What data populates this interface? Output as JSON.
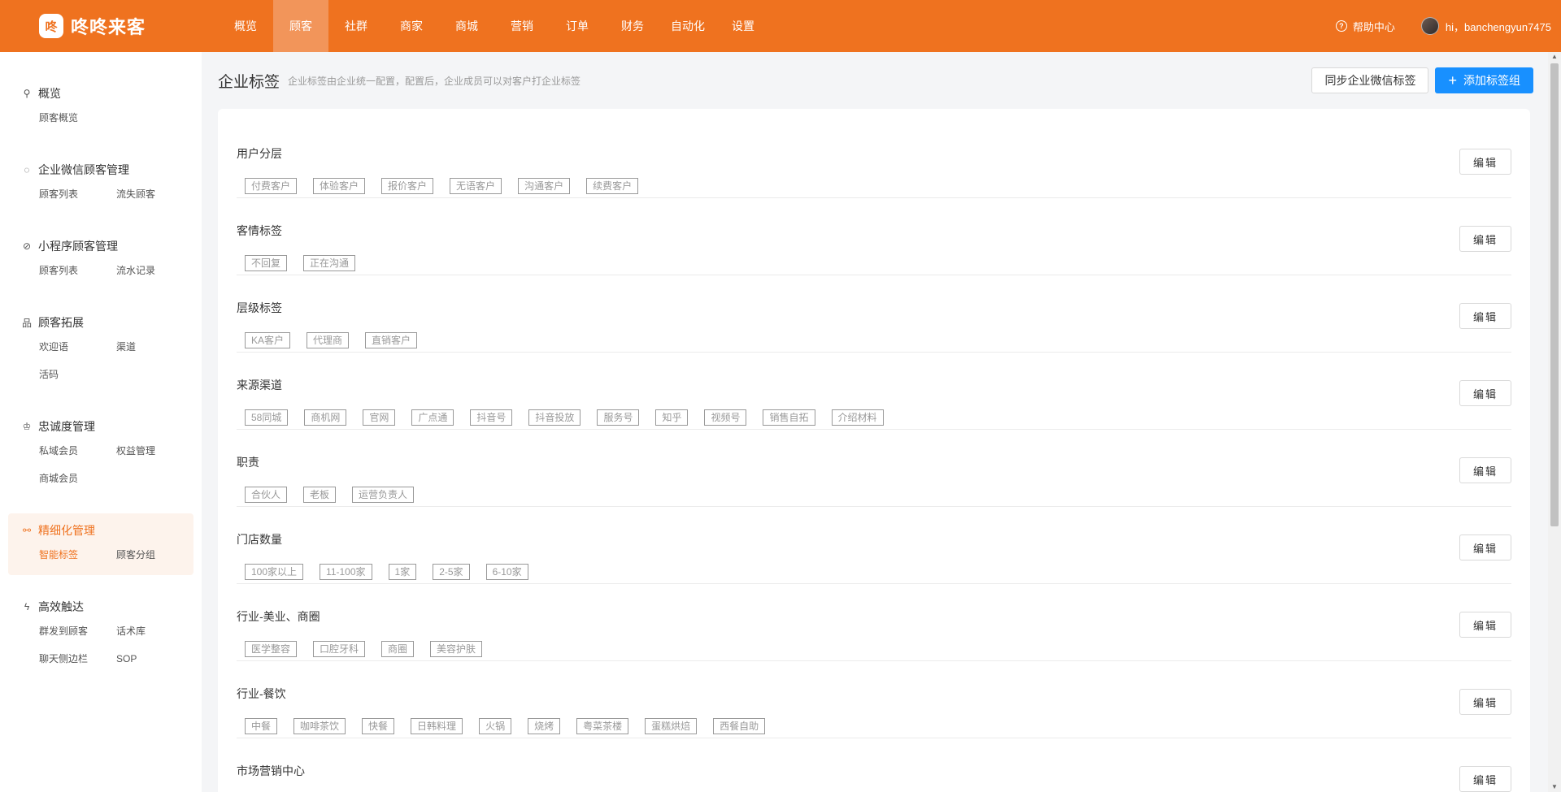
{
  "app": {
    "logo_glyph": "咚",
    "name": "咚咚来客"
  },
  "nav": [
    {
      "label": "概览",
      "active": false
    },
    {
      "label": "顾客",
      "active": true
    },
    {
      "label": "社群",
      "active": false
    },
    {
      "label": "商家",
      "active": false
    },
    {
      "label": "商城",
      "active": false
    },
    {
      "label": "营销",
      "active": false
    },
    {
      "label": "订单",
      "active": false
    },
    {
      "label": "财务",
      "active": false
    },
    {
      "label": "自动化",
      "active": false
    },
    {
      "label": "设置",
      "active": false
    }
  ],
  "header_right": {
    "help_label": "帮助中心",
    "greeting": "hi，banchengyun7475"
  },
  "sidebar": [
    {
      "title": "概览",
      "icon": "user-icon",
      "glyph": "⚲",
      "items": [
        "顾客概览"
      ]
    },
    {
      "title": "企业微信顾客管理",
      "icon": "chat-icon",
      "glyph": "◌",
      "items": [
        "顾客列表",
        "流失顾客"
      ]
    },
    {
      "title": "小程序顾客管理",
      "icon": "compass-icon",
      "glyph": "⊘",
      "items": [
        "顾客列表",
        "流水记录"
      ]
    },
    {
      "title": "顾客拓展",
      "icon": "org-icon",
      "glyph": "品",
      "items": [
        "欢迎语",
        "渠道",
        "活码"
      ]
    },
    {
      "title": "忠诚度管理",
      "icon": "crown-icon",
      "glyph": "♔",
      "items": [
        "私域会员",
        "权益管理",
        "商城会员"
      ]
    },
    {
      "title": "精细化管理",
      "icon": "share-icon",
      "glyph": "⚯",
      "active": true,
      "items": [
        "智能标签",
        "顾客分组"
      ],
      "active_item": 0
    },
    {
      "title": "高效触达",
      "icon": "lightning-icon",
      "glyph": "ϟ",
      "items": [
        "群发到顾客",
        "话术库",
        "聊天侧边栏",
        "SOP"
      ]
    }
  ],
  "page": {
    "title": "企业标签",
    "description": "企业标签由企业统一配置，配置后，企业成员可以对客户打企业标签",
    "sync_button": "同步企业微信标签",
    "add_button": "添加标签组",
    "edit_label": "编辑"
  },
  "tag_groups": [
    {
      "name": "用户分层",
      "tags": [
        "付费客户",
        "体验客户",
        "报价客户",
        "无语客户",
        "沟通客户",
        "续费客户"
      ]
    },
    {
      "name": "客情标签",
      "tags": [
        "不回复",
        "正在沟通"
      ]
    },
    {
      "name": "层级标签",
      "tags": [
        "KA客户",
        "代理商",
        "直销客户"
      ]
    },
    {
      "name": "来源渠道",
      "tags": [
        "58同城",
        "商机网",
        "官网",
        "广点通",
        "抖音号",
        "抖音投放",
        "服务号",
        "知乎",
        "视频号",
        "销售自拓",
        "介绍材料"
      ]
    },
    {
      "name": "职责",
      "tags": [
        "合伙人",
        "老板",
        "运营负责人"
      ]
    },
    {
      "name": "门店数量",
      "tags": [
        "100家以上",
        "11-100家",
        "1家",
        "2-5家",
        "6-10家"
      ]
    },
    {
      "name": "行业-美业、商圈",
      "tags": [
        "医学整容",
        "口腔牙科",
        "商圈",
        "美容护肤"
      ]
    },
    {
      "name": "行业-餐饮",
      "tags": [
        "中餐",
        "咖啡茶饮",
        "快餐",
        "日韩料理",
        "火锅",
        "烧烤",
        "粤菜茶楼",
        "蛋糕烘焙",
        "西餐自助"
      ]
    },
    {
      "name": "市场营销中心",
      "tags": []
    }
  ]
}
